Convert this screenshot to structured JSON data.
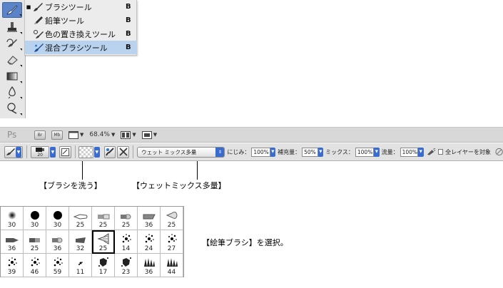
{
  "tools_panel": {
    "tools": [
      {
        "name": "brush-tool",
        "active": true
      },
      {
        "name": "clone-stamp-tool",
        "active": false
      },
      {
        "name": "history-brush-tool",
        "active": false
      },
      {
        "name": "eraser-tool",
        "active": false
      },
      {
        "name": "gradient-tool",
        "active": false
      },
      {
        "name": "blur-tool",
        "active": false
      },
      {
        "name": "dodge-tool",
        "active": false
      }
    ],
    "flyout": [
      {
        "label": "ブラシツール",
        "key": "B",
        "bullet": "■",
        "icon": "brush-icon",
        "selected": false
      },
      {
        "label": "鉛筆ツール",
        "key": "B",
        "bullet": "",
        "icon": "pencil-icon",
        "selected": false
      },
      {
        "label": "色の置き換えツール",
        "key": "B",
        "bullet": "",
        "icon": "color-replacement-icon",
        "selected": false
      },
      {
        "label": "混合ブラシツール",
        "key": "B",
        "bullet": "",
        "icon": "mixer-brush-icon",
        "selected": true
      }
    ]
  },
  "app_bar": {
    "logo": "Ps",
    "bridge_label": "Br",
    "minibridge_label": "Mb",
    "zoom": "68.4%"
  },
  "options_bar": {
    "brush_size": "20",
    "wet_mix_preset": "ウェット ミックス多量",
    "wet_label": "にじみ：",
    "wet_value": "100%",
    "load_label": "補充量：",
    "load_value": "50%",
    "mix_label": "ミックス：",
    "mix_value": "100%",
    "flow_label": "流量：",
    "flow_value": "100%",
    "sample_all_label": "全レイヤーを対象"
  },
  "callouts": {
    "clean_brush": "【ブラシを洗う】",
    "wet_mix": "【ウェットミックス多量】",
    "paint_brush": "【絵筆ブラシ】を選択。"
  },
  "brush_presets": [
    {
      "size": "30",
      "shape": "soft-round"
    },
    {
      "size": "30",
      "shape": "hard-round"
    },
    {
      "size": "30",
      "shape": "hard-round"
    },
    {
      "size": "25",
      "shape": "round-bristle"
    },
    {
      "size": "25",
      "shape": "flat-bristle"
    },
    {
      "size": "25",
      "shape": "round-blunt"
    },
    {
      "size": "36",
      "shape": "flat-curve"
    },
    {
      "size": "25",
      "shape": "fan"
    },
    {
      "size": "36",
      "shape": "round-point"
    },
    {
      "size": "25",
      "shape": "flat-blunt"
    },
    {
      "size": "36",
      "shape": "round-blunt"
    },
    {
      "size": "32",
      "shape": "flat-angle"
    },
    {
      "size": "25",
      "shape": "fan-stiff",
      "selected": true
    },
    {
      "size": "14",
      "shape": "splatter"
    },
    {
      "size": "24",
      "shape": "splatter"
    },
    {
      "size": "27",
      "shape": "splatter"
    },
    {
      "size": "39",
      "shape": "splatter"
    },
    {
      "size": "46",
      "shape": "splatter"
    },
    {
      "size": "59",
      "shape": "splatter"
    },
    {
      "size": "11",
      "shape": "splatter-small"
    },
    {
      "size": "17",
      "shape": "splatter-dense"
    },
    {
      "size": "23",
      "shape": "splatter-dense"
    },
    {
      "size": "36",
      "shape": "grass"
    },
    {
      "size": "44",
      "shape": "grass"
    }
  ]
}
